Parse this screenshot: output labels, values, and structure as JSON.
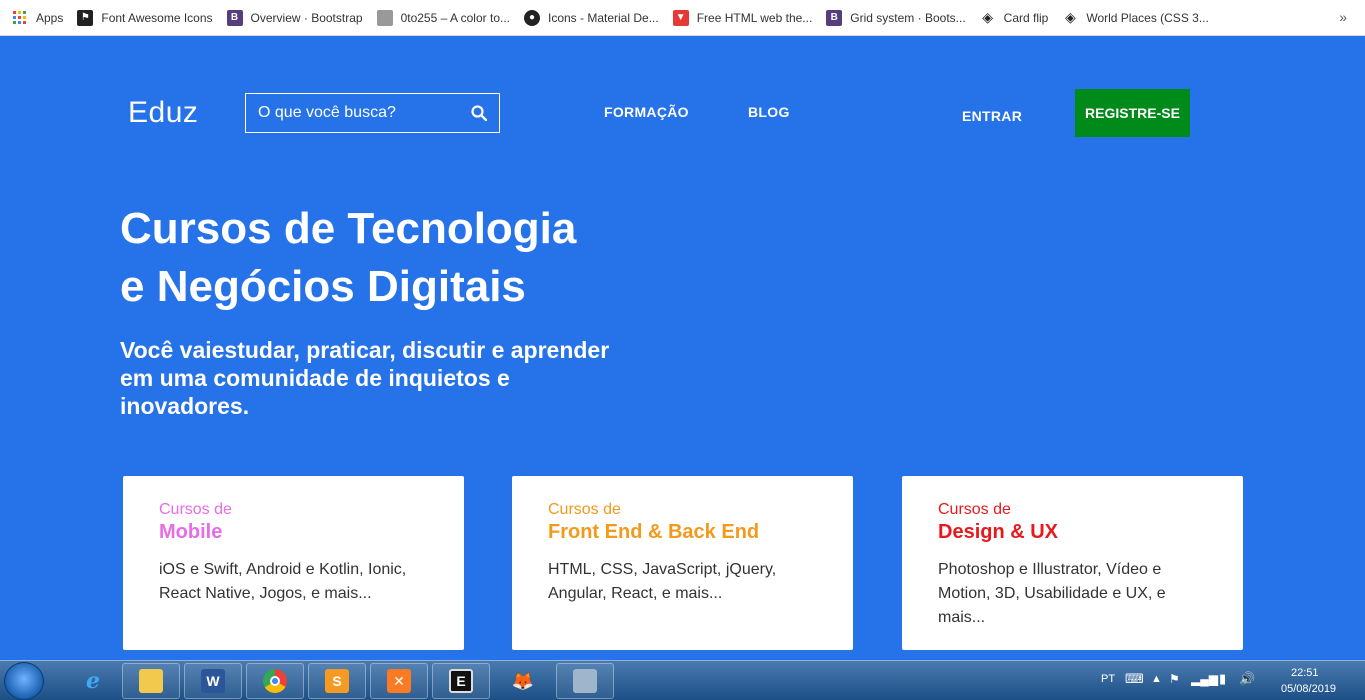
{
  "bookmarks": [
    {
      "label": "Apps",
      "icon": "apps-grid-icon",
      "color": "#e74c3c"
    },
    {
      "label": "Font Awesome Icons",
      "icon": "flag-icon",
      "color": "#222222"
    },
    {
      "label": "Overview · Bootstrap",
      "icon": "bootstrap-icon",
      "color": "#563d7c"
    },
    {
      "label": "0to255 – A color to...",
      "icon": "page-icon",
      "color": "#888888"
    },
    {
      "label": "Icons - Material De...",
      "icon": "github-icon",
      "color": "#222222"
    },
    {
      "label": "Free HTML web the...",
      "icon": "template-icon",
      "color": "#e53935"
    },
    {
      "label": "Grid system · Boots...",
      "icon": "bootstrap-icon",
      "color": "#563d7c"
    },
    {
      "label": "Card flip",
      "icon": "codepen-icon",
      "color": "#222222"
    },
    {
      "label": "World Places (CSS 3...",
      "icon": "codepen-icon",
      "color": "#222222"
    }
  ],
  "more_label": "»",
  "header": {
    "logo": "Eduz",
    "search_placeholder": "O que você busca?",
    "nav_formacao": "FORMAÇÃO",
    "nav_blog": "BLOG",
    "nav_entrar": "ENTRAR",
    "register_label": "REGISTRE-SE"
  },
  "hero": {
    "title_line1": "Cursos de Tecnologia",
    "title_line2": "e Negócios Digitais",
    "subtitle": "Você vaiestudar, praticar, discutir e aprender em uma comunidade de inquietos e inovadores."
  },
  "cards": [
    {
      "pre": "Cursos de",
      "title": "Mobile",
      "desc": "iOS e Swift, Android e Kotlin, Ionic, React Native, Jogos, e mais...",
      "color": "#e86be8"
    },
    {
      "pre": "Cursos de",
      "title": "Front End & Back End",
      "desc": "HTML, CSS, JavaScript, jQuery, Angular, React, e mais...",
      "color": "#f39a1c"
    },
    {
      "pre": "Cursos de",
      "title": "Design & UX",
      "desc": "Photoshop e Illustrator, Vídeo e Motion, 3D, Usabilidade e UX, e mais...",
      "color": "#e8191c"
    }
  ],
  "colors": {
    "page_bg": "#2672e8",
    "register_bg": "#008a1a"
  },
  "taskbar": {
    "apps": [
      "folder-icon",
      "word-icon",
      "chrome-icon",
      "sublime-icon",
      "xampp-icon",
      "terminal-icon",
      "gimp-icon",
      "window-icon"
    ],
    "lang": "PT",
    "time": "22:51",
    "date": "05/08/2019"
  }
}
